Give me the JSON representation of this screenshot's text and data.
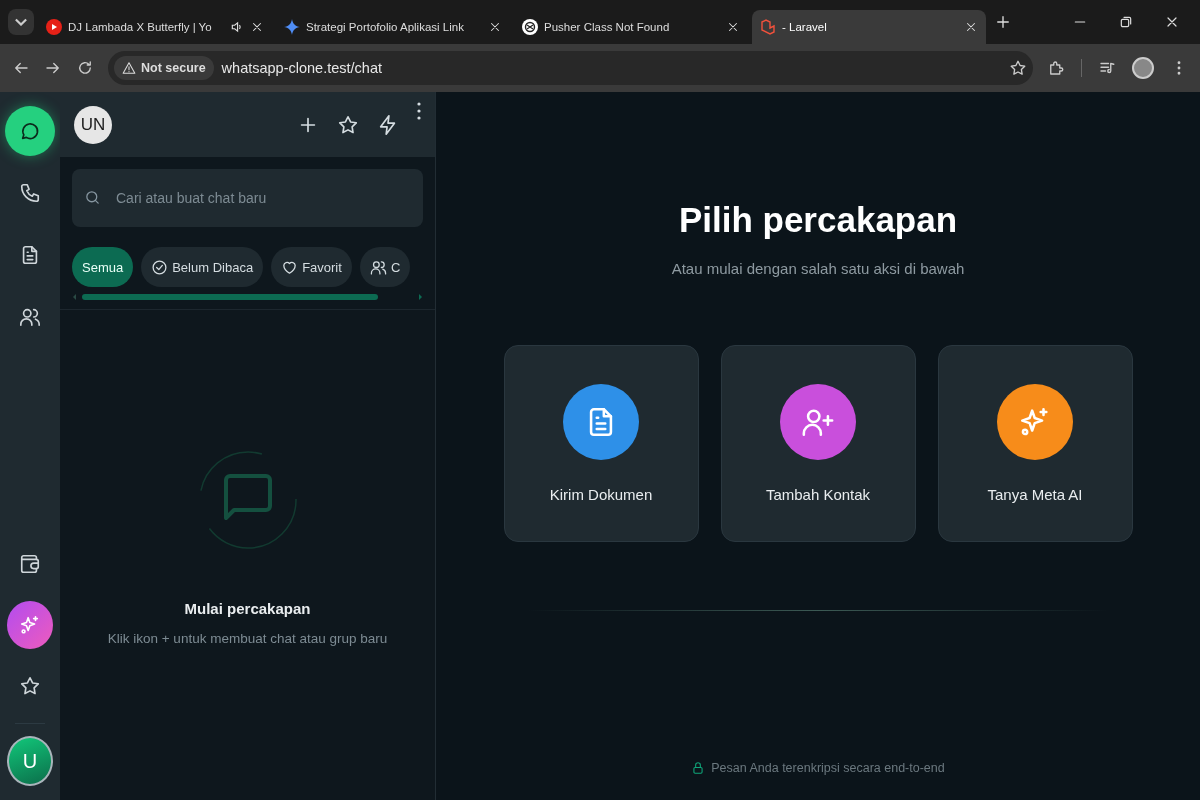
{
  "browser": {
    "tabs": [
      {
        "title": "DJ Lambada X Butterfly | Yo",
        "selected": false,
        "audio": true
      },
      {
        "title": "Strategi Portofolio Aplikasi Link",
        "selected": false,
        "audio": false
      },
      {
        "title": "Pusher Class Not Found",
        "selected": false,
        "audio": false
      },
      {
        "title": "- Laravel",
        "selected": true,
        "audio": false
      }
    ],
    "security": "Not secure",
    "url": "whatsapp-clone.test/chat"
  },
  "rail": {
    "top": [
      {
        "selected": true
      },
      {
        "selected": false
      },
      {
        "selected": false
      },
      {
        "selected": false
      }
    ],
    "user_avatar": "U"
  },
  "chat_list": {
    "avatar": "UN",
    "search": {
      "placeholder": "Cari atau buat chat baru"
    },
    "filters": [
      {
        "label": "Semua",
        "selected": true
      },
      {
        "label": "Belum Dibaca",
        "selected": false
      },
      {
        "label": "Favorit",
        "selected": false
      },
      {
        "label": "C",
        "selected": false
      }
    ],
    "empty_title": "Mulai percakapan",
    "empty_hint": "Klik ikon + untuk membuat chat atau grup baru"
  },
  "main": {
    "title": "Pilih percakapan",
    "subtitle": "Atau mulai dengan salah satu aksi di bawah",
    "actions": [
      {
        "label": "Kirim Dokumen",
        "color": "#2e90e8"
      },
      {
        "label": "Tambah Kontak",
        "color": "#c94fdc"
      },
      {
        "label": "Tanya Meta AI",
        "color": "#f78c1a"
      }
    ],
    "footer": "Pesan Anda terenkripsi secara end-to-end"
  }
}
